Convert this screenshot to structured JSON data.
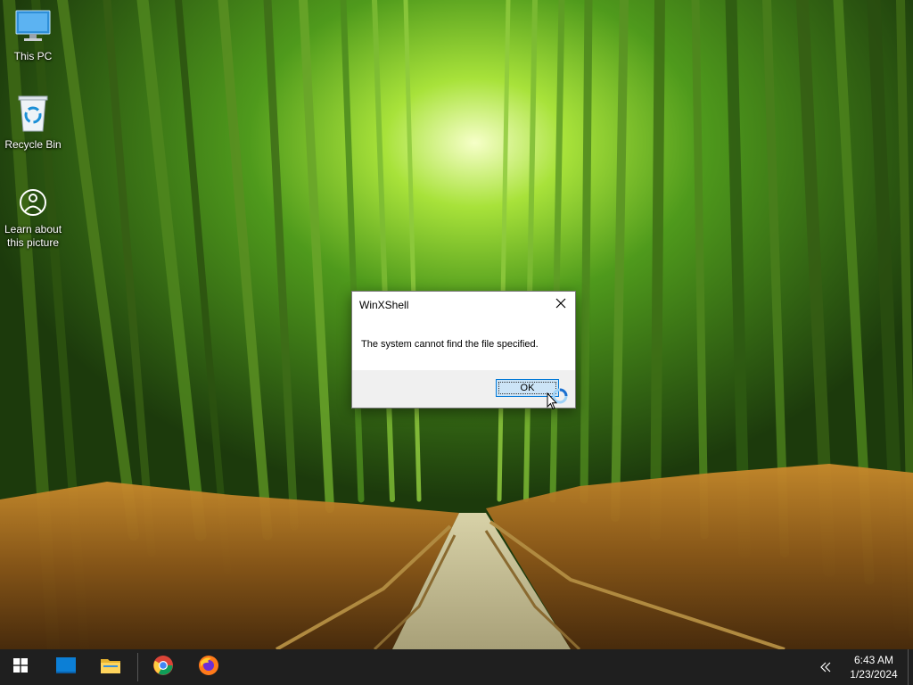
{
  "desktop": {
    "icons": [
      {
        "label": "This PC",
        "icon": "this-pc-icon"
      },
      {
        "label": "Recycle Bin",
        "icon": "recycle-bin-icon"
      },
      {
        "label": "Learn about this picture",
        "icon": "learn-about-picture-icon"
      }
    ]
  },
  "dialog": {
    "title": "WinXShell",
    "message": "The system cannot find the file specified.",
    "ok_label": "OK",
    "close_icon": "close-icon"
  },
  "taskbar": {
    "items": [
      {
        "name": "start",
        "icon": "windows-start-icon"
      },
      {
        "name": "desktop",
        "icon": "show-desktop-icon"
      },
      {
        "name": "file-explorer",
        "icon": "folder-icon"
      },
      {
        "name": "chrome",
        "icon": "chrome-icon"
      },
      {
        "name": "firefox",
        "icon": "firefox-icon"
      }
    ],
    "tray_icon": "chevron-left-icon",
    "time": "6:43 AM",
    "date": "1/23/2024"
  },
  "colors": {
    "taskbar": "#1f1f1f",
    "dialog_footer": "#f0f0f0",
    "button_fill": "#cce4f7",
    "button_border": "#0078d7",
    "windows_blue": "#0078d7"
  }
}
